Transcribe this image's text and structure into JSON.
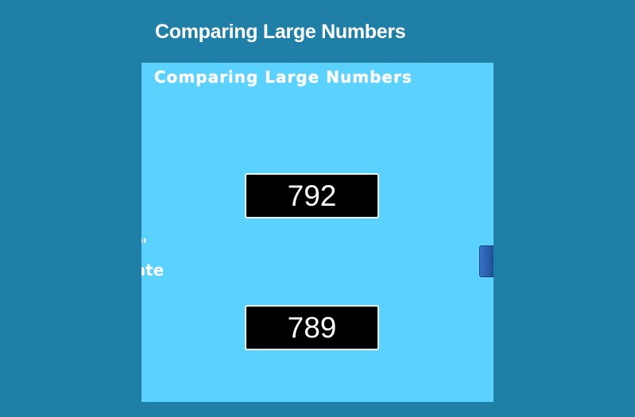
{
  "page": {
    "title": "Comparing Large Numbers"
  },
  "app": {
    "title": "Comparing Large Numbers",
    "instructions_fragment": "EXT\"\nnerate\ners",
    "numbers": {
      "top": "792",
      "bottom": "789"
    }
  },
  "colors": {
    "page_background": "#1f7fa6",
    "app_background": "#5bd2fd",
    "number_box_background": "#000000",
    "side_tab": "#2d62b0"
  },
  "icons": {
    "side_tab": "side-panel-tab-icon"
  }
}
